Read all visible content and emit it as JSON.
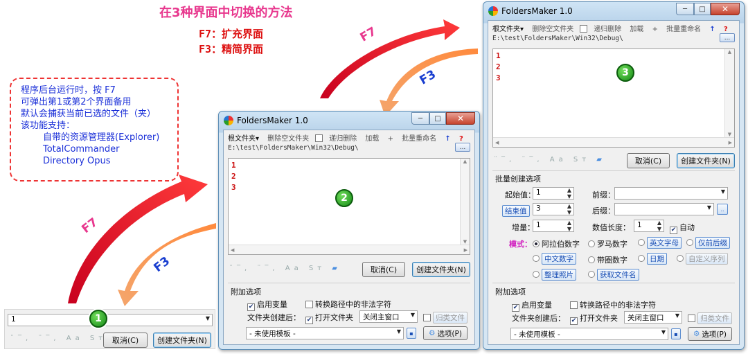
{
  "heading": "在3种界面中切换的方法",
  "keys": [
    "F7：扩充界面",
    "F3：精简界面"
  ],
  "note": {
    "lines": [
      "程序后台运行时，按 F7",
      "可弹出第1或第2个界面备用",
      "默认会捕获当前已选的文件（夹）",
      "该功能支持："
    ],
    "supported": [
      "自带的资源管理器(Explorer)",
      "TotalCommander",
      "Directory Opus"
    ]
  },
  "arrows": {
    "f7": "F7",
    "f3": "F3"
  },
  "markers": [
    "1",
    "2",
    "3"
  ],
  "app_title": "FoldersMaker 1.0",
  "window_controls": {
    "min": "─",
    "max": "□",
    "close": "✕"
  },
  "toolbar": {
    "root": "根文件夹▾",
    "del_empty": "删除空文件夹",
    "recursive": "递归删除",
    "load": "加载",
    "plus": "+",
    "batch_rename": "批量重命名",
    "up": "↑",
    "help": "?"
  },
  "path": "E:\\test\\FoldersMaker\\Win32\\Debug\\",
  "ellipsis": "...",
  "lines": [
    "1",
    "2",
    "3"
  ],
  "input_value": "1",
  "tool_icons": {
    "a": "¨‾,",
    "b": "¨‾,",
    "c": "Aa",
    "d": "Sт",
    "e": "▰"
  },
  "cancel": "取消(C)",
  "create": "创建文件夹(N)",
  "extra": {
    "title": "附加选项",
    "enable_var": "启用变量",
    "convert_illegal": "转换路径中的非法字符",
    "after_create": "文件夹创建后：",
    "open_folder": "打开文件夹",
    "close_main": "关闭主窗口",
    "classify": "归类文件",
    "template": "- 未使用模板 -",
    "options": "选项(P)"
  },
  "batch": {
    "title": "批量创建选项",
    "start_label": "起始值：",
    "start_value": "1",
    "end_label": "结束值",
    "end_value": "3",
    "step_label": "增量：",
    "step_value": "1",
    "prefix_label": "前缀：",
    "suffix_label": "后缀：",
    "digits_label": "数值长度：",
    "digits_value": "1",
    "auto": "自动",
    "mode_label": "模式：",
    "modes": {
      "arabic": "阿拉伯数字",
      "roman": "罗马数字",
      "en_letters": "英文字母",
      "prefix_suffix": "仅前后缀",
      "cn_numbers": "中文数字",
      "circled": "带圈数字",
      "date": "日期",
      "custom": "自定义序列",
      "photos": "整理照片",
      "filenames": "获取文件名"
    },
    "browse": ".."
  }
}
